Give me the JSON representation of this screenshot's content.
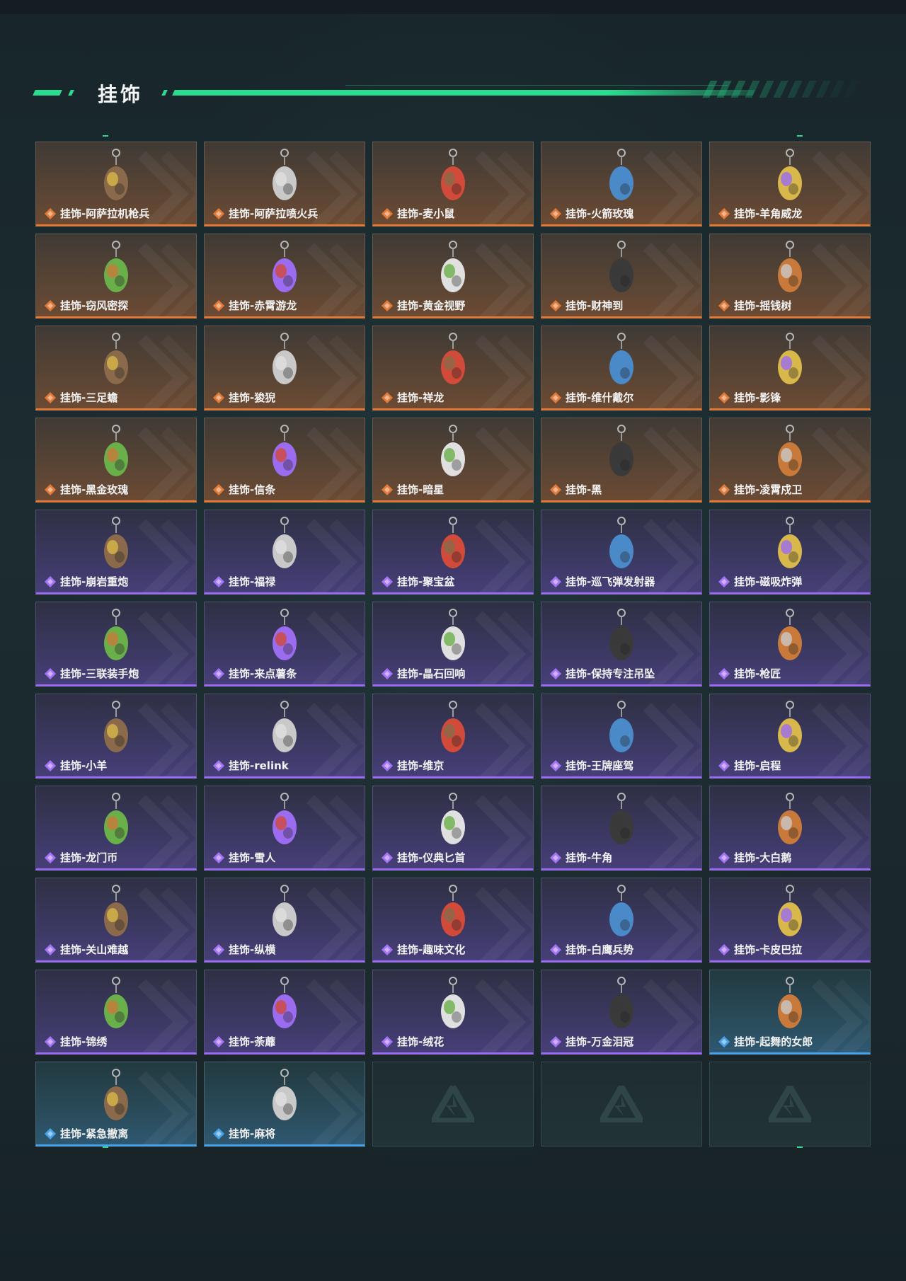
{
  "header": {
    "title": "挂饰"
  },
  "colors": {
    "accent": "#2bdc8f",
    "orange": "#e27a3a",
    "purple": "#9b6cf0",
    "blue": "#4aa3e6"
  },
  "items": [
    {
      "name": "挂饰-阿萨拉机枪兵",
      "rarity": "orange"
    },
    {
      "name": "挂饰-阿萨拉喷火兵",
      "rarity": "orange"
    },
    {
      "name": "挂饰-麦小鼠",
      "rarity": "orange"
    },
    {
      "name": "挂饰-火箭玫瑰",
      "rarity": "orange"
    },
    {
      "name": "挂饰-羊角威龙",
      "rarity": "orange"
    },
    {
      "name": "挂饰-窃风密探",
      "rarity": "orange"
    },
    {
      "name": "挂饰-赤霄游龙",
      "rarity": "orange"
    },
    {
      "name": "挂饰-黄金视野",
      "rarity": "orange"
    },
    {
      "name": "挂饰-财神到",
      "rarity": "orange"
    },
    {
      "name": "挂饰-摇钱树",
      "rarity": "orange"
    },
    {
      "name": "挂饰-三足蟾",
      "rarity": "orange"
    },
    {
      "name": "挂饰-狻猊",
      "rarity": "orange"
    },
    {
      "name": "挂饰-祥龙",
      "rarity": "orange"
    },
    {
      "name": "挂饰-维什戴尔",
      "rarity": "orange"
    },
    {
      "name": "挂饰-影锋",
      "rarity": "orange"
    },
    {
      "name": "挂饰-黑金玫瑰",
      "rarity": "orange"
    },
    {
      "name": "挂饰-信条",
      "rarity": "orange"
    },
    {
      "name": "挂饰-暗星",
      "rarity": "orange"
    },
    {
      "name": "挂饰-黑",
      "rarity": "orange"
    },
    {
      "name": "挂饰-凌霄戍卫",
      "rarity": "orange"
    },
    {
      "name": "挂饰-崩岩重炮",
      "rarity": "purple"
    },
    {
      "name": "挂饰-福禄",
      "rarity": "purple"
    },
    {
      "name": "挂饰-聚宝盆",
      "rarity": "purple"
    },
    {
      "name": "挂饰-巡飞弹发射器",
      "rarity": "purple"
    },
    {
      "name": "挂饰-磁吸炸弹",
      "rarity": "purple"
    },
    {
      "name": "挂饰-三联装手炮",
      "rarity": "purple"
    },
    {
      "name": "挂饰-来点薯条",
      "rarity": "purple"
    },
    {
      "name": "挂饰-晶石回响",
      "rarity": "purple"
    },
    {
      "name": "挂饰-保持专注吊坠",
      "rarity": "purple"
    },
    {
      "name": "挂饰-枪匠",
      "rarity": "purple"
    },
    {
      "name": "挂饰-小羊",
      "rarity": "purple"
    },
    {
      "name": "挂饰-relink",
      "rarity": "purple"
    },
    {
      "name": "挂饰-维京",
      "rarity": "purple"
    },
    {
      "name": "挂饰-王牌座驾",
      "rarity": "purple"
    },
    {
      "name": "挂饰-启程",
      "rarity": "purple"
    },
    {
      "name": "挂饰-龙门币",
      "rarity": "purple"
    },
    {
      "name": "挂饰-雪人",
      "rarity": "purple"
    },
    {
      "name": "挂饰-仪典匕首",
      "rarity": "purple"
    },
    {
      "name": "挂饰-牛角",
      "rarity": "purple"
    },
    {
      "name": "挂饰-大白鹅",
      "rarity": "purple"
    },
    {
      "name": "挂饰-关山难越",
      "rarity": "purple"
    },
    {
      "name": "挂饰-纵横",
      "rarity": "purple"
    },
    {
      "name": "挂饰-趣味文化",
      "rarity": "purple"
    },
    {
      "name": "挂饰-白鹰兵势",
      "rarity": "purple"
    },
    {
      "name": "挂饰-卡皮巴拉",
      "rarity": "purple"
    },
    {
      "name": "挂饰-锦绣",
      "rarity": "purple"
    },
    {
      "name": "挂饰-荼蘼",
      "rarity": "purple"
    },
    {
      "name": "挂饰-绒花",
      "rarity": "purple"
    },
    {
      "name": "挂饰-万金泪冠",
      "rarity": "purple"
    },
    {
      "name": "挂饰-起舞的女郎",
      "rarity": "blue"
    },
    {
      "name": "挂饰-紧急撤离",
      "rarity": "blue"
    },
    {
      "name": "挂饰-麻将",
      "rarity": "blue"
    },
    {
      "name": "",
      "rarity": "empty"
    },
    {
      "name": "",
      "rarity": "empty"
    },
    {
      "name": "",
      "rarity": "empty"
    }
  ]
}
